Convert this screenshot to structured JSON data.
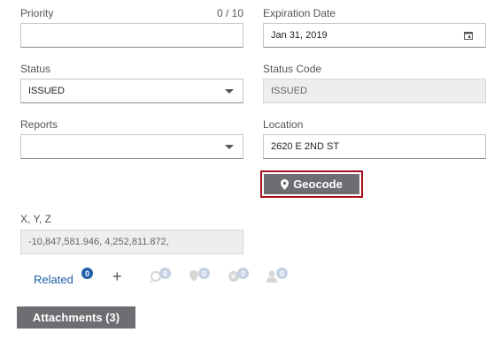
{
  "priority": {
    "label": "Priority",
    "counter": "0 / 10",
    "value": ""
  },
  "expiration": {
    "label": "Expiration Date",
    "value": "Jan 31, 2019"
  },
  "status": {
    "label": "Status",
    "value": "ISSUED"
  },
  "status_code": {
    "label": "Status Code",
    "value": "ISSUED"
  },
  "reports": {
    "label": "Reports",
    "value": ""
  },
  "location": {
    "label": "Location",
    "value": "2620 E 2ND ST"
  },
  "geocode": {
    "label": "Geocode"
  },
  "xyz": {
    "label": "X, Y, Z",
    "value": "-10,847,581.946, 4,252,811.872,"
  },
  "related": {
    "label": "Related",
    "count": "0",
    "add_label": "+",
    "icons": [
      {
        "name": "related-search-icon",
        "count": "0"
      },
      {
        "name": "related-map-pin-icon",
        "count": "0"
      },
      {
        "name": "related-globe-icon",
        "count": "0"
      },
      {
        "name": "related-person-icon",
        "count": "0"
      }
    ]
  },
  "attachments": {
    "label": "Attachments (3)"
  },
  "colors": {
    "accent": "#1f5fa8",
    "button_gray": "#6d6e71",
    "focus_red": "#a3121c"
  }
}
